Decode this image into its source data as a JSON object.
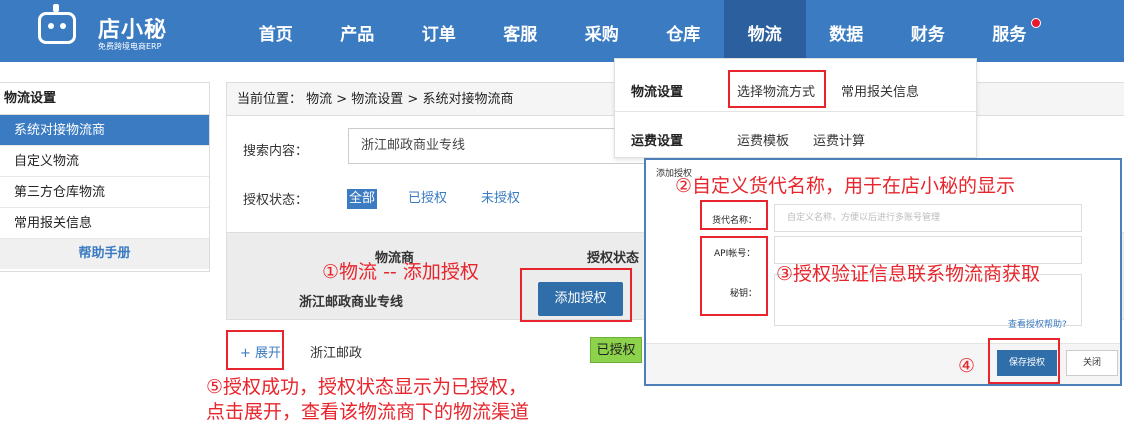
{
  "app": {
    "logo_name": "店小秘",
    "logo_sub": "免费跨境电商ERP",
    "brand_color": "#3a7bc2",
    "accent_red": "#e8252c"
  },
  "nav": {
    "items": [
      "首页",
      "产品",
      "订单",
      "客服",
      "采购",
      "仓库",
      "物流",
      "数据",
      "财务",
      "服务"
    ],
    "active": "物流"
  },
  "sidebar": {
    "title": "物流设置",
    "items": [
      "系统对接物流商",
      "自定义物流",
      "第三方仓库物流",
      "常用报关信息"
    ],
    "active": "系统对接物流商",
    "help": "帮助手册"
  },
  "breadcrumb": {
    "text": "当前位置： 物流 > 物流设置 > 系统对接物流商"
  },
  "search": {
    "label": "搜索内容：",
    "value": "浙江邮政商业专线"
  },
  "auth_filter": {
    "label": "授权状态：",
    "options": [
      "全部",
      "已授权",
      "未授权"
    ],
    "selected": "全部"
  },
  "table": {
    "headers": [
      "物流商",
      "授权状态"
    ],
    "group_name": "浙江邮政商业专线",
    "add_button": "添加授权",
    "row": {
      "expand": "+ 展开",
      "name": "浙江邮政",
      "status": "已授权"
    }
  },
  "dropdown": {
    "rows": [
      {
        "head": "物流设置",
        "links": [
          "选择物流方式",
          "常用报关信息"
        ]
      },
      {
        "head": "运费设置",
        "links": [
          "运费模板",
          "运费计算"
        ]
      }
    ]
  },
  "modal": {
    "title": "添加授权",
    "fields": {
      "alias_label": "货代名称：",
      "alias_placeholder": "自定义名称，方便以后进行多账号管理",
      "api_label": "API帐号：",
      "secret_label": "秘钥："
    },
    "help": "查看授权帮助?",
    "save": "保存授权",
    "close": "关闭"
  },
  "annotations": {
    "n1": "①物流 -- 添加授权",
    "n2": "②自定义货代名称，用于在店小秘的显示",
    "n3": "③授权验证信息联系物流商获取",
    "n4": "④",
    "n5_line1": "⑤授权成功，授权状态显示为已授权，",
    "n5_line2": "点击展开，查看该物流商下的物流渠道"
  }
}
